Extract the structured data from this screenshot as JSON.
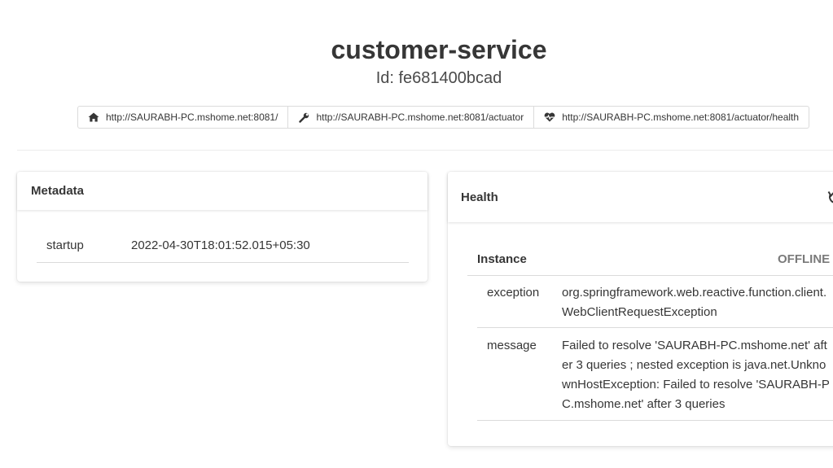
{
  "app": {
    "name": "customer-service",
    "id_text": "Id: fe681400bcad"
  },
  "links": [
    {
      "icon": "home-icon",
      "text": "http://SAURABH-PC.mshome.net:8081/"
    },
    {
      "icon": "wrench-icon",
      "text": "http://SAURABH-PC.mshome.net:8081/actuator"
    },
    {
      "icon": "heartbeat-icon",
      "text": "http://SAURABH-PC.mshome.net:8081/actuator/health"
    }
  ],
  "metadata": {
    "title": "Metadata",
    "rows": [
      {
        "key": "startup",
        "value": "2022-04-30T18:01:52.015+05:30"
      }
    ]
  },
  "health": {
    "title": "Health",
    "instance_label": "Instance",
    "status": "OFFLINE",
    "status_color": "#7a7a7a",
    "details": [
      {
        "key": "exception",
        "value": "org.springframework.web.reactive.function.client.WebClientRequestException"
      },
      {
        "key": "message",
        "value": "Failed to resolve 'SAURABH-PC.mshome.net' after 3 queries ; nested exception is java.net.UnknownHostException: Failed to resolve 'SAURABH-PC.mshome.net' after 3 queries"
      }
    ]
  }
}
